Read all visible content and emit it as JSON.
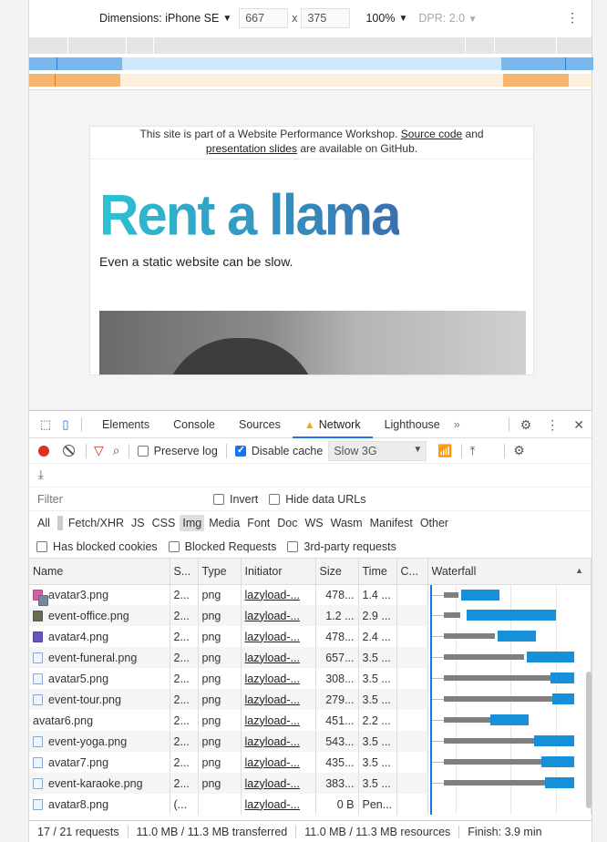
{
  "device_toolbar": {
    "dimensions_label": "Dimensions: iPhone SE",
    "width": "667",
    "height": "375",
    "times": "x",
    "zoom": "100%",
    "dpr": "DPR: 2.0",
    "more_icon": "kebab-icon"
  },
  "page": {
    "notice_pre": "This site is part of a Website Performance Workshop.",
    "notice_link1": "Source code",
    "notice_mid": "and",
    "notice_link2": "presentation slides",
    "notice_post": "are available on GitHub.",
    "hero_title": "Rent a llama",
    "tagline": "Even a static website can be slow.",
    "hero_colors": [
      "#2cc2d4",
      "#3a6fb0"
    ]
  },
  "devtools": {
    "tabs": [
      {
        "label": "Elements"
      },
      {
        "label": "Console"
      },
      {
        "label": "Sources"
      },
      {
        "label": "Network"
      },
      {
        "label": "Lighthouse"
      }
    ],
    "more_tabs": "»",
    "toolbar": {
      "preserve_log": "Preserve log",
      "disable_cache": "Disable cache",
      "throttle": "Slow 3G"
    },
    "filter_placeholder": "Filter",
    "invert": "Invert",
    "hide_data_urls": "Hide data URLs",
    "types": [
      "All",
      "Fetch/XHR",
      "JS",
      "CSS",
      "Img",
      "Media",
      "Font",
      "Doc",
      "WS",
      "Wasm",
      "Manifest",
      "Other"
    ],
    "selected_type": "Img",
    "has_blocked_cookies": "Has blocked cookies",
    "blocked_requests": "Blocked Requests",
    "third_party": "3rd-party requests",
    "columns": [
      "Name",
      "S...",
      "Type",
      "Initiator",
      "Size",
      "Time",
      "C...",
      "Waterfall"
    ],
    "rows": [
      {
        "name": "avatar3.png",
        "status": "2...",
        "type": "png",
        "initiator": "lazyload-...",
        "size": "478...",
        "time": "1.4 ...",
        "icon": "pink",
        "wait": [
          5,
          16
        ],
        "dl": [
          36,
          78
        ]
      },
      {
        "name": "event-office.png",
        "status": "2...",
        "type": "png",
        "initiator": "lazyload-...",
        "size": "1.2 ...",
        "time": "2.9 ...",
        "icon": "dark",
        "wait": [
          5,
          18
        ],
        "dl": [
          42,
          140
        ]
      },
      {
        "name": "avatar4.png",
        "status": "2...",
        "type": "png",
        "initiator": "lazyload-...",
        "size": "478...",
        "time": "2.4 ...",
        "icon": "purple",
        "wait": [
          5,
          56
        ],
        "dl": [
          76,
          118
        ]
      },
      {
        "name": "event-funeral.png",
        "status": "2...",
        "type": "png",
        "initiator": "lazyload-...",
        "size": "657...",
        "time": "3.5 ...",
        "icon": "file",
        "wait": [
          5,
          88
        ],
        "dl": [
          108,
          160
        ]
      },
      {
        "name": "avatar5.png",
        "status": "2...",
        "type": "png",
        "initiator": "lazyload-...",
        "size": "308...",
        "time": "3.5 ...",
        "icon": "file",
        "wait": [
          5,
          118
        ],
        "dl": [
          134,
          160
        ]
      },
      {
        "name": "event-tour.png",
        "status": "2...",
        "type": "png",
        "initiator": "lazyload-...",
        "size": "279...",
        "time": "3.5 ...",
        "icon": "file",
        "wait": [
          5,
          120
        ],
        "dl": [
          136,
          160
        ]
      },
      {
        "name": "avatar6.png",
        "status": "2...",
        "type": "png",
        "initiator": "lazyload-...",
        "size": "451...",
        "time": "2.2 ...",
        "icon": "photo",
        "wait": [
          5,
          52
        ],
        "dl": [
          68,
          110
        ]
      },
      {
        "name": "event-yoga.png",
        "status": "2...",
        "type": "png",
        "initiator": "lazyload-...",
        "size": "543...",
        "time": "3.5 ...",
        "icon": "file",
        "wait": [
          5,
          100
        ],
        "dl": [
          116,
          160
        ]
      },
      {
        "name": "avatar7.png",
        "status": "2...",
        "type": "png",
        "initiator": "lazyload-...",
        "size": "435...",
        "time": "3.5 ...",
        "icon": "file",
        "wait": [
          5,
          108
        ],
        "dl": [
          124,
          160
        ]
      },
      {
        "name": "event-karaoke.png",
        "status": "2...",
        "type": "png",
        "initiator": "lazyload-...",
        "size": "383...",
        "time": "3.5 ...",
        "icon": "file",
        "wait": [
          5,
          112
        ],
        "dl": [
          128,
          160
        ]
      },
      {
        "name": "avatar8.png",
        "status": "(...",
        "type": "",
        "initiator": "lazyload-...",
        "size": "0 B",
        "time": "Pen...",
        "icon": "file",
        "wait": [
          0,
          0
        ],
        "dl": [
          0,
          0
        ]
      }
    ],
    "status": {
      "requests": "17 / 21 requests",
      "transferred": "11.0 MB / 11.3 MB transferred",
      "resources": "11.0 MB / 11.3 MB resources",
      "finish": "Finish: 3.9 min"
    }
  }
}
